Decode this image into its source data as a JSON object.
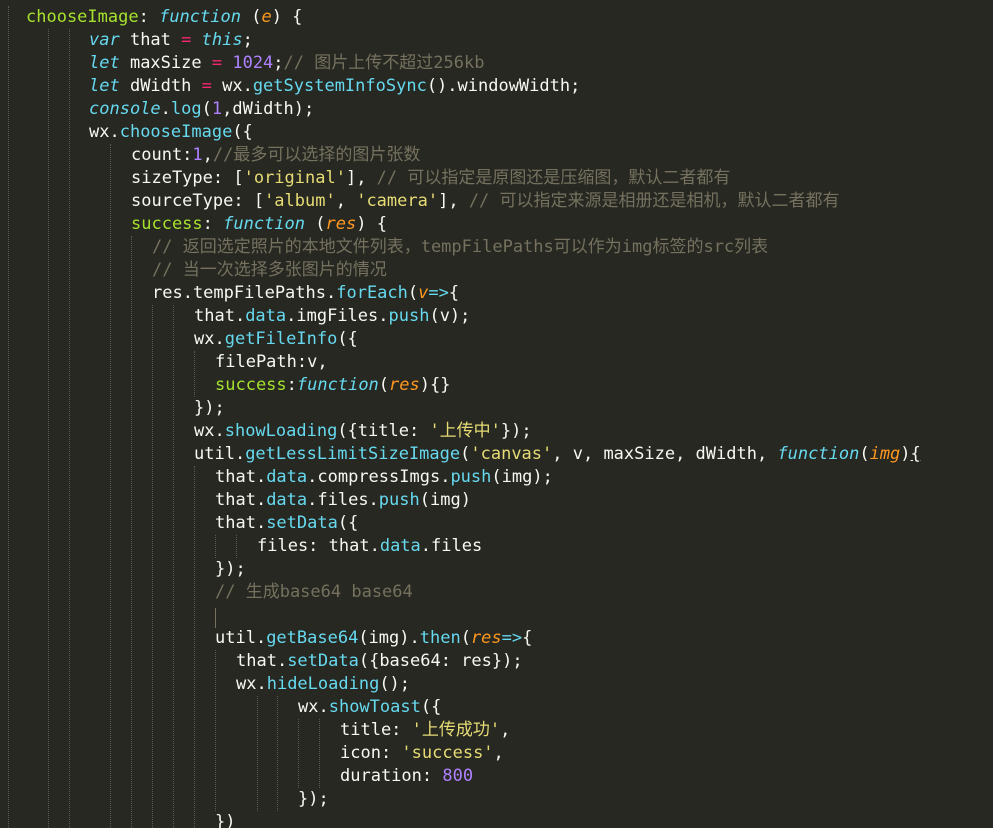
{
  "editor": {
    "theme": {
      "background": "#272822",
      "foreground": "#f8f8f2",
      "function_name": "#a6e22e",
      "keyword": "#66d9ef",
      "operator": "#f92672",
      "number": "#ae81ff",
      "string": "#e6db74",
      "comment": "#75715e",
      "parameter": "#fd971f"
    },
    "lines": [
      {
        "indent": 26,
        "tokens": [
          {
            "t": "chooseImage",
            "c": "fn"
          },
          {
            "t": ": ",
            "c": "txt"
          },
          {
            "t": "function",
            "c": "kw"
          },
          {
            "t": " (",
            "c": "txt"
          },
          {
            "t": "e",
            "c": "param"
          },
          {
            "t": ") {",
            "c": "txt"
          }
        ]
      },
      {
        "indent": 89,
        "tokens": [
          {
            "t": "var",
            "c": "kw"
          },
          {
            "t": " that ",
            "c": "txt"
          },
          {
            "t": "=",
            "c": "op"
          },
          {
            "t": " ",
            "c": "txt"
          },
          {
            "t": "this",
            "c": "kw"
          },
          {
            "t": ";",
            "c": "txt"
          }
        ]
      },
      {
        "indent": 89,
        "tokens": [
          {
            "t": "let",
            "c": "kw"
          },
          {
            "t": " maxSize ",
            "c": "txt"
          },
          {
            "t": "=",
            "c": "op"
          },
          {
            "t": " ",
            "c": "txt"
          },
          {
            "t": "1024",
            "c": "num"
          },
          {
            "t": ";",
            "c": "txt"
          },
          {
            "t": "// 图片上传不超过256kb",
            "c": "cm"
          }
        ]
      },
      {
        "indent": 89,
        "tokens": [
          {
            "t": "let",
            "c": "kw"
          },
          {
            "t": " dWidth ",
            "c": "txt"
          },
          {
            "t": "=",
            "c": "op"
          },
          {
            "t": " wx.",
            "c": "txt"
          },
          {
            "t": "getSystemInfoSync",
            "c": "prop"
          },
          {
            "t": "().windowWidth;",
            "c": "txt"
          }
        ]
      },
      {
        "indent": 89,
        "tokens": [
          {
            "t": "console",
            "c": "kw"
          },
          {
            "t": ".",
            "c": "txt"
          },
          {
            "t": "log",
            "c": "prop"
          },
          {
            "t": "(",
            "c": "txt"
          },
          {
            "t": "1",
            "c": "num"
          },
          {
            "t": ",dWidth);",
            "c": "txt"
          }
        ]
      },
      {
        "indent": 89,
        "tokens": [
          {
            "t": "wx.",
            "c": "txt"
          },
          {
            "t": "chooseImage",
            "c": "prop"
          },
          {
            "t": "({",
            "c": "txt"
          }
        ]
      },
      {
        "indent": 131,
        "tokens": [
          {
            "t": "count:",
            "c": "txt"
          },
          {
            "t": "1",
            "c": "num"
          },
          {
            "t": ",",
            "c": "txt"
          },
          {
            "t": "//最多可以选择的图片张数",
            "c": "cm"
          }
        ]
      },
      {
        "indent": 131,
        "tokens": [
          {
            "t": "sizeType: [",
            "c": "txt"
          },
          {
            "t": "'original'",
            "c": "str"
          },
          {
            "t": "], ",
            "c": "txt"
          },
          {
            "t": "// 可以指定是原图还是压缩图，默认二者都有",
            "c": "cm"
          }
        ]
      },
      {
        "indent": 131,
        "tokens": [
          {
            "t": "sourceType: [",
            "c": "txt"
          },
          {
            "t": "'album'",
            "c": "str"
          },
          {
            "t": ", ",
            "c": "txt"
          },
          {
            "t": "'camera'",
            "c": "str"
          },
          {
            "t": "], ",
            "c": "txt"
          },
          {
            "t": "// 可以指定来源是相册还是相机，默认二者都有",
            "c": "cm"
          }
        ]
      },
      {
        "indent": 131,
        "tokens": [
          {
            "t": "success",
            "c": "fn"
          },
          {
            "t": ": ",
            "c": "txt"
          },
          {
            "t": "function",
            "c": "kw"
          },
          {
            "t": " (",
            "c": "txt"
          },
          {
            "t": "res",
            "c": "param"
          },
          {
            "t": ") {",
            "c": "txt"
          }
        ]
      },
      {
        "indent": 152,
        "tokens": [
          {
            "t": "// 返回选定照片的本地文件列表，tempFilePaths可以作为img标签的src列表",
            "c": "cm"
          }
        ]
      },
      {
        "indent": 152,
        "tokens": [
          {
            "t": "// 当一次选择多张图片的情况",
            "c": "cm"
          }
        ]
      },
      {
        "indent": 152,
        "tokens": [
          {
            "t": "res.tempFilePaths.",
            "c": "txt"
          },
          {
            "t": "forEach",
            "c": "prop"
          },
          {
            "t": "(",
            "c": "txt"
          },
          {
            "t": "v",
            "c": "param"
          },
          {
            "t": "=>",
            "c": "kw"
          },
          {
            "t": "{",
            "c": "txt"
          }
        ]
      },
      {
        "indent": 194,
        "tokens": [
          {
            "t": "that.",
            "c": "txt"
          },
          {
            "t": "data",
            "c": "prop"
          },
          {
            "t": ".imgFiles.",
            "c": "txt"
          },
          {
            "t": "push",
            "c": "prop"
          },
          {
            "t": "(v);",
            "c": "txt"
          }
        ]
      },
      {
        "indent": 194,
        "tokens": [
          {
            "t": "wx.",
            "c": "txt"
          },
          {
            "t": "getFileInfo",
            "c": "prop"
          },
          {
            "t": "({",
            "c": "txt"
          }
        ]
      },
      {
        "indent": 215,
        "tokens": [
          {
            "t": "filePath:v,",
            "c": "txt"
          }
        ]
      },
      {
        "indent": 215,
        "tokens": [
          {
            "t": "success",
            "c": "fn"
          },
          {
            "t": ":",
            "c": "txt"
          },
          {
            "t": "function",
            "c": "kw"
          },
          {
            "t": "(",
            "c": "txt"
          },
          {
            "t": "res",
            "c": "param"
          },
          {
            "t": "){}",
            "c": "txt"
          }
        ]
      },
      {
        "indent": 194,
        "tokens": [
          {
            "t": "});",
            "c": "txt"
          }
        ]
      },
      {
        "indent": 194,
        "tokens": [
          {
            "t": "wx.",
            "c": "txt"
          },
          {
            "t": "showLoading",
            "c": "prop"
          },
          {
            "t": "({title: ",
            "c": "txt"
          },
          {
            "t": "'上传中'",
            "c": "str"
          },
          {
            "t": "});",
            "c": "txt"
          }
        ]
      },
      {
        "indent": 194,
        "tokens": [
          {
            "t": "util.",
            "c": "txt"
          },
          {
            "t": "getLessLimitSizeImage",
            "c": "prop"
          },
          {
            "t": "(",
            "c": "txt"
          },
          {
            "t": "'canvas'",
            "c": "str"
          },
          {
            "t": ", v, maxSize, dWidth, ",
            "c": "txt"
          },
          {
            "t": "function",
            "c": "kw"
          },
          {
            "t": "(",
            "c": "txt"
          },
          {
            "t": "img",
            "c": "param"
          },
          {
            "t": ")",
            "c": "txt"
          },
          {
            "t": "{",
            "c": "u"
          }
        ]
      },
      {
        "indent": 215,
        "tokens": [
          {
            "t": "that.",
            "c": "txt"
          },
          {
            "t": "data",
            "c": "prop"
          },
          {
            "t": ".compressImgs.",
            "c": "txt"
          },
          {
            "t": "push",
            "c": "prop"
          },
          {
            "t": "(img);",
            "c": "txt"
          }
        ]
      },
      {
        "indent": 215,
        "tokens": [
          {
            "t": "that.",
            "c": "txt"
          },
          {
            "t": "data",
            "c": "prop"
          },
          {
            "t": ".files.",
            "c": "txt"
          },
          {
            "t": "push",
            "c": "prop"
          },
          {
            "t": "(img)",
            "c": "txt"
          }
        ]
      },
      {
        "indent": 215,
        "tokens": [
          {
            "t": "that.",
            "c": "txt"
          },
          {
            "t": "setData",
            "c": "prop"
          },
          {
            "t": "({",
            "c": "txt"
          }
        ]
      },
      {
        "indent": 257,
        "tokens": [
          {
            "t": "files: that.",
            "c": "txt"
          },
          {
            "t": "data",
            "c": "prop"
          },
          {
            "t": ".files",
            "c": "txt"
          }
        ]
      },
      {
        "indent": 215,
        "tokens": [
          {
            "t": "});",
            "c": "txt"
          }
        ]
      },
      {
        "indent": 215,
        "tokens": [
          {
            "t": "// 生成base64 base64",
            "c": "cm"
          }
        ]
      },
      {
        "indent": 215,
        "tokens": []
      },
      {
        "indent": 215,
        "tokens": [
          {
            "t": "util.",
            "c": "txt"
          },
          {
            "t": "getBase64",
            "c": "prop"
          },
          {
            "t": "(img).",
            "c": "txt"
          },
          {
            "t": "then",
            "c": "prop"
          },
          {
            "t": "(",
            "c": "txt"
          },
          {
            "t": "res",
            "c": "param"
          },
          {
            "t": "=>",
            "c": "kw"
          },
          {
            "t": "{",
            "c": "txt"
          }
        ]
      },
      {
        "indent": 236,
        "tokens": [
          {
            "t": "that.",
            "c": "txt"
          },
          {
            "t": "setData",
            "c": "prop"
          },
          {
            "t": "({base64: res});",
            "c": "txt"
          }
        ]
      },
      {
        "indent": 236,
        "tokens": [
          {
            "t": "wx.",
            "c": "txt"
          },
          {
            "t": "hideLoading",
            "c": "prop"
          },
          {
            "t": "();",
            "c": "txt"
          }
        ]
      },
      {
        "indent": 298,
        "tokens": [
          {
            "t": "wx.",
            "c": "txt"
          },
          {
            "t": "showToast",
            "c": "prop"
          },
          {
            "t": "({",
            "c": "txt"
          }
        ]
      },
      {
        "indent": 340,
        "tokens": [
          {
            "t": "title: ",
            "c": "txt"
          },
          {
            "t": "'上传成功'",
            "c": "str"
          },
          {
            "t": ",",
            "c": "txt"
          }
        ]
      },
      {
        "indent": 340,
        "tokens": [
          {
            "t": "icon: ",
            "c": "txt"
          },
          {
            "t": "'success'",
            "c": "str"
          },
          {
            "t": ",",
            "c": "txt"
          }
        ]
      },
      {
        "indent": 340,
        "tokens": [
          {
            "t": "duration: ",
            "c": "txt"
          },
          {
            "t": "800",
            "c": "num"
          }
        ]
      },
      {
        "indent": 298,
        "tokens": [
          {
            "t": "});",
            "c": "txt"
          }
        ]
      },
      {
        "indent": 215,
        "tokens": [
          {
            "t": "})",
            "c": "txt"
          }
        ]
      }
    ]
  }
}
